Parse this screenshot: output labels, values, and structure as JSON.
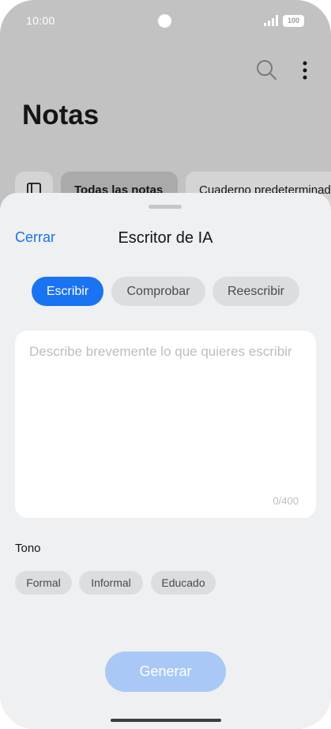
{
  "status_bar": {
    "time": "10:00",
    "battery": "100",
    "icons": [
      "camera-dot",
      "signal-icon",
      "battery-icon"
    ]
  },
  "background_app": {
    "title": "Notas",
    "icons": [
      "search-icon",
      "more-vertical-icon",
      "sidebar-icon"
    ],
    "chips": {
      "all_notes": "Todas las notas",
      "default_notebook": "Cuaderno predeterminado"
    }
  },
  "sheet": {
    "close_label": "Cerrar",
    "title": "Escritor de IA",
    "tabs": {
      "write": "Escribir",
      "check": "Comprobar",
      "rewrite": "Reescribir"
    },
    "active_tab": "write",
    "prompt": {
      "value": "",
      "placeholder": "Describe brevemente lo que quieres escribir",
      "counter": "0/400"
    },
    "tone": {
      "label": "Tono",
      "options": {
        "formal": "Formal",
        "informal": "Informal",
        "polite": "Educado"
      }
    },
    "generate_label": "Generar"
  },
  "colors": {
    "accent": "#1a73f0",
    "accent_disabled": "#a9c8f5",
    "scrim": "#c2c2c2",
    "sheet": "#eff0f2"
  }
}
